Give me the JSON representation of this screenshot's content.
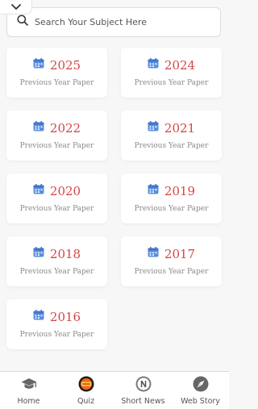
{
  "search": {
    "placeholder": "Search Your Subject Here"
  },
  "colors": {
    "year": "#d64545",
    "calendar": "#5b8fe0",
    "subtitle": "#8a8a8a"
  },
  "cards": [
    {
      "year": "2025",
      "subtitle": "Previous Year Paper"
    },
    {
      "year": "2024",
      "subtitle": "Previous Year Paper"
    },
    {
      "year": "2022",
      "subtitle": "Previous Year Paper"
    },
    {
      "year": "2021",
      "subtitle": "Previous Year Paper"
    },
    {
      "year": "2020",
      "subtitle": "Previous Year Paper"
    },
    {
      "year": "2019",
      "subtitle": "Previous Year Paper"
    },
    {
      "year": "2018",
      "subtitle": "Previous Year Paper"
    },
    {
      "year": "2017",
      "subtitle": "Previous Year Paper"
    },
    {
      "year": "2016",
      "subtitle": "Previous Year Paper"
    }
  ],
  "bottom_nav": {
    "items": [
      {
        "label": "Home",
        "icon": "graduation-cap-icon"
      },
      {
        "label": "Quiz",
        "icon": "quiz-badge-icon"
      },
      {
        "label": "Short News",
        "icon": "news-icon"
      },
      {
        "label": "Web Story",
        "icon": "compass-icon"
      }
    ]
  }
}
